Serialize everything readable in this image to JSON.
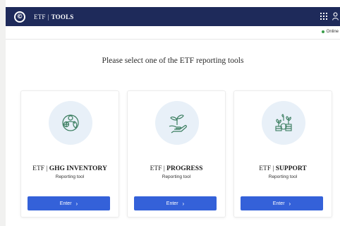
{
  "header": {
    "logo_glyph": "©",
    "brand_left": "ETF",
    "brand_sep": "|",
    "brand_right": "TOOLS",
    "apps_icon": "apps-grid-icon",
    "user_icon": "user-icon"
  },
  "status": {
    "label": "Online",
    "color": "#3a9d4a"
  },
  "headline": "Please select one of the ETF reporting tools",
  "cards": [
    {
      "icon": "globe-people-icon",
      "prefix": "ETF |",
      "name": "GHG INVENTORY",
      "subtitle": "Reporting tool",
      "button": "Enter",
      "chevron": "›"
    },
    {
      "icon": "plant-in-hand-icon",
      "prefix": "ETF |",
      "name": "PROGRESS",
      "subtitle": "Reporting tool",
      "button": "Enter",
      "chevron": "›"
    },
    {
      "icon": "coins-plants-icon",
      "prefix": "ETF |",
      "name": "SUPPORT",
      "subtitle": "Reporting tool",
      "button": "Enter",
      "chevron": "›"
    }
  ],
  "colors": {
    "header_bg": "#1e2a5a",
    "button_bg": "#3461d9",
    "icon_bg": "#e8f0f8",
    "icon_stroke": "#3a7d5f"
  }
}
